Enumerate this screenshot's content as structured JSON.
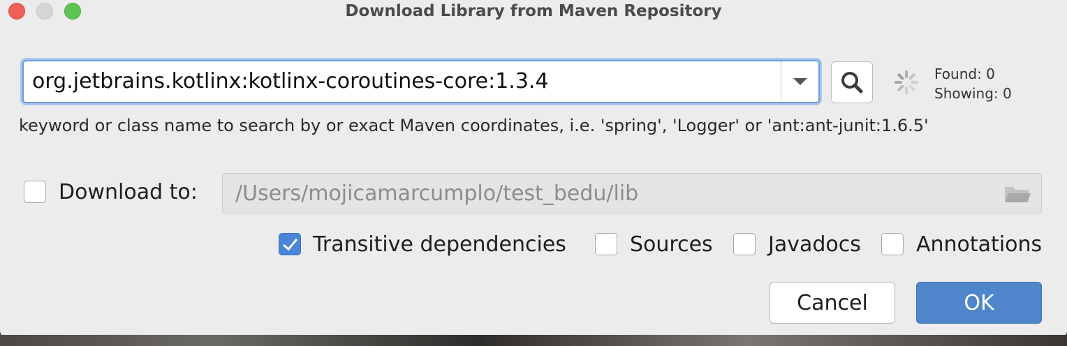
{
  "window": {
    "title": "Download Library from Maven Repository"
  },
  "search": {
    "value": "org.jetbrains.kotlinx:kotlinx-coroutines-core:1.3.4",
    "hint": "keyword or class name to search by or exact Maven coordinates, i.e. 'spring', 'Logger' or 'ant:ant-junit:1.6.5'",
    "search_icon": "magnifier-icon",
    "dropdown_icon": "chevron-down-icon",
    "status_icon": "spinner-icon"
  },
  "results": {
    "found": "Found: 0",
    "showing": "Showing: 0"
  },
  "download_to": {
    "label": "Download to:",
    "checked": false,
    "path": "/Users/mojicamarcumplo/test_bedu/lib",
    "browse_icon": "folder-icon"
  },
  "options": [
    {
      "label": "Transitive dependencies",
      "checked": true
    },
    {
      "label": "Sources",
      "checked": false
    },
    {
      "label": "Javadocs",
      "checked": false
    },
    {
      "label": "Annotations",
      "checked": false
    }
  ],
  "buttons": {
    "cancel": "Cancel",
    "ok": "OK"
  },
  "colors": {
    "accent": "#4f86cb",
    "focus_ring": "#a9c6ee",
    "checkbox_checked": "#4a86d8"
  }
}
